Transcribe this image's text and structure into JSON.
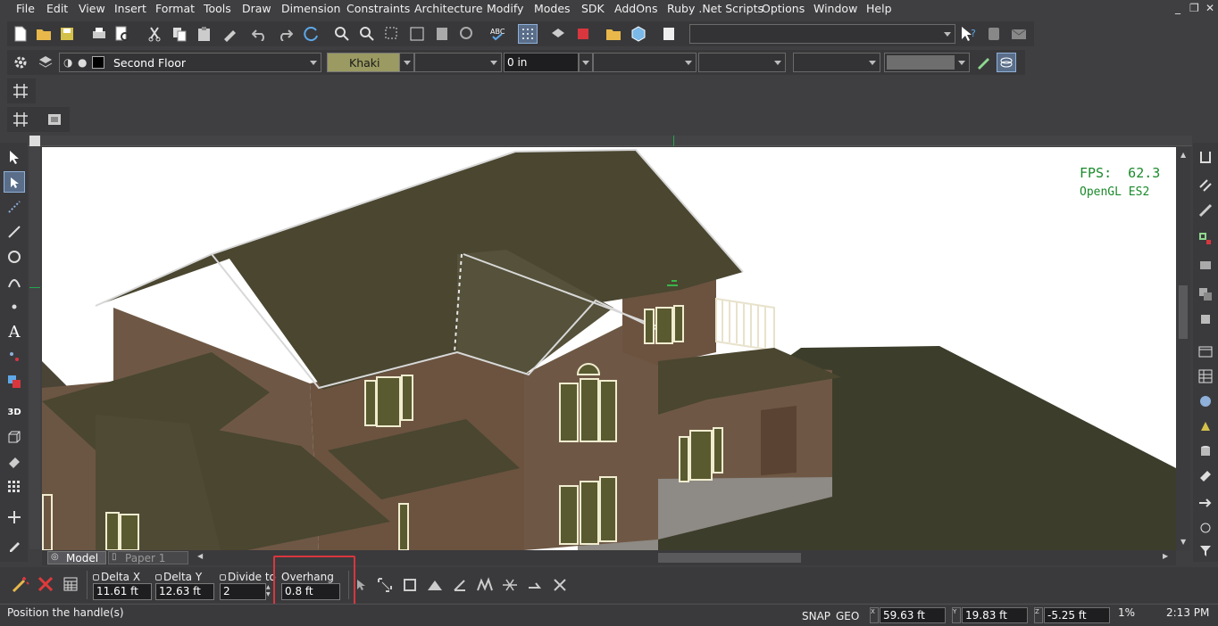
{
  "menu": [
    "File",
    "Edit",
    "View",
    "Insert",
    "Format",
    "Tools",
    "Draw",
    "Dimension",
    "Constraints",
    "Architecture",
    "Modify",
    "Modes",
    "SDK",
    "AddOns",
    "Ruby .Net Scripts",
    "Options",
    "Window",
    "Help"
  ],
  "layer": {
    "name": "Second Floor",
    "color": "Khaki"
  },
  "linetype_value": "0 in",
  "viewport": {
    "fps_label": "FPS:  62.3",
    "renderer": "OpenGL ES2"
  },
  "tabs": {
    "model": "Model",
    "paper": "Paper 1"
  },
  "inspector": {
    "delta_x": {
      "label": "Delta X",
      "value": "11.61 ft"
    },
    "delta_y": {
      "label": "Delta Y",
      "value": "12.63 ft"
    },
    "divide": {
      "label": "Divide to",
      "value": "2"
    },
    "overhang": {
      "label": "Overhang",
      "value": "0.8 ft"
    }
  },
  "status": {
    "prompt": "Position the handle(s)",
    "snap": "SNAP",
    "geo": "GEO",
    "x": "59.63 ft",
    "y": "19.83 ft",
    "z": "-5.25 ft",
    "zoom": "1%",
    "time": "2:13 PM"
  },
  "colors": {
    "khaki": "#9a9a62",
    "highlight": "#d9363e",
    "accent": "#5a6e8a"
  }
}
